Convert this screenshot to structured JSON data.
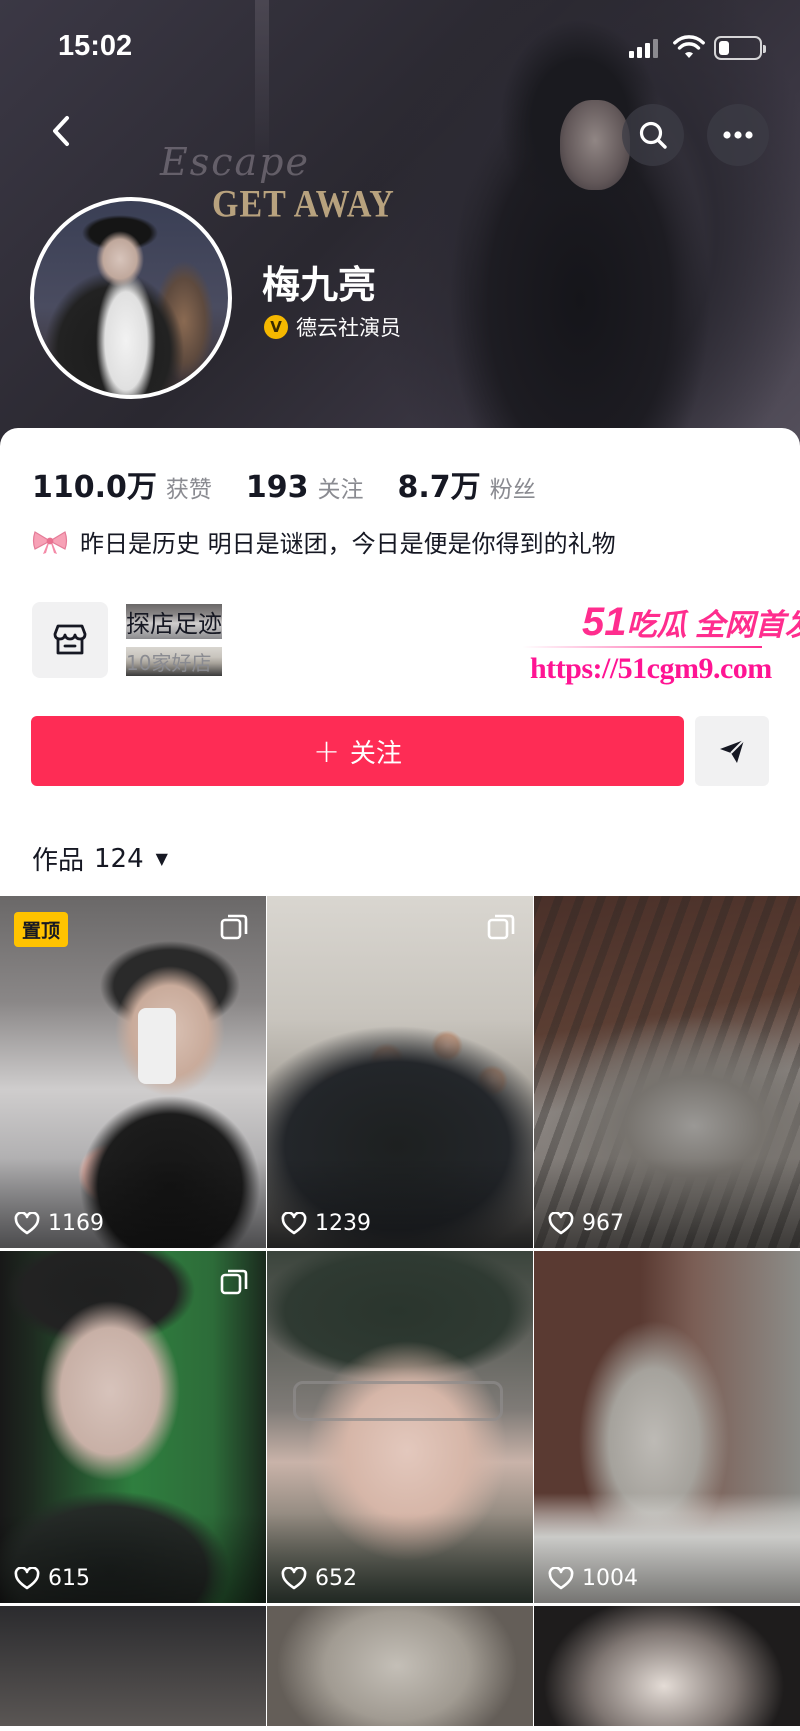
{
  "status_bar": {
    "time": "15:02"
  },
  "cover": {
    "text_escape": "Escape",
    "text_getaway": "GET AWAY"
  },
  "profile": {
    "name": "梅九亮",
    "verified_badge": "V",
    "verified_label": "德云社演员"
  },
  "stats": [
    {
      "value": "110.0万",
      "label": "获赞"
    },
    {
      "value": "193",
      "label": "关注"
    },
    {
      "value": "8.7万",
      "label": "粉丝"
    }
  ],
  "bio": "昨日是历史 明日是谜团，今日是便是你得到的礼物",
  "store": {
    "title": "探店足迹",
    "subtitle": "10家好店"
  },
  "watermark": {
    "line1_big": "51",
    "line1_rest": "吃瓜 全网首发",
    "line2": "https://51cgm9.com"
  },
  "follow_button": {
    "plus": "+",
    "label": "关注"
  },
  "works_tab": {
    "label": "作品",
    "count": "124"
  },
  "pinned_label": "置顶",
  "tiles": [
    {
      "likes": "1169"
    },
    {
      "likes": "1239"
    },
    {
      "likes": "967"
    },
    {
      "likes": "615"
    },
    {
      "likes": "652"
    },
    {
      "likes": "1004"
    }
  ],
  "colors": {
    "accent": "#fe2c55",
    "pin": "#ffc300",
    "verify": "#f5b800",
    "watermark": "#ff2d8e"
  },
  "icons": [
    "back-icon",
    "search-icon",
    "more-icon",
    "verified-icon",
    "bow-emoji-icon",
    "store-icon",
    "share-icon",
    "caret-down-icon",
    "heart-icon",
    "multi-image-icon"
  ]
}
